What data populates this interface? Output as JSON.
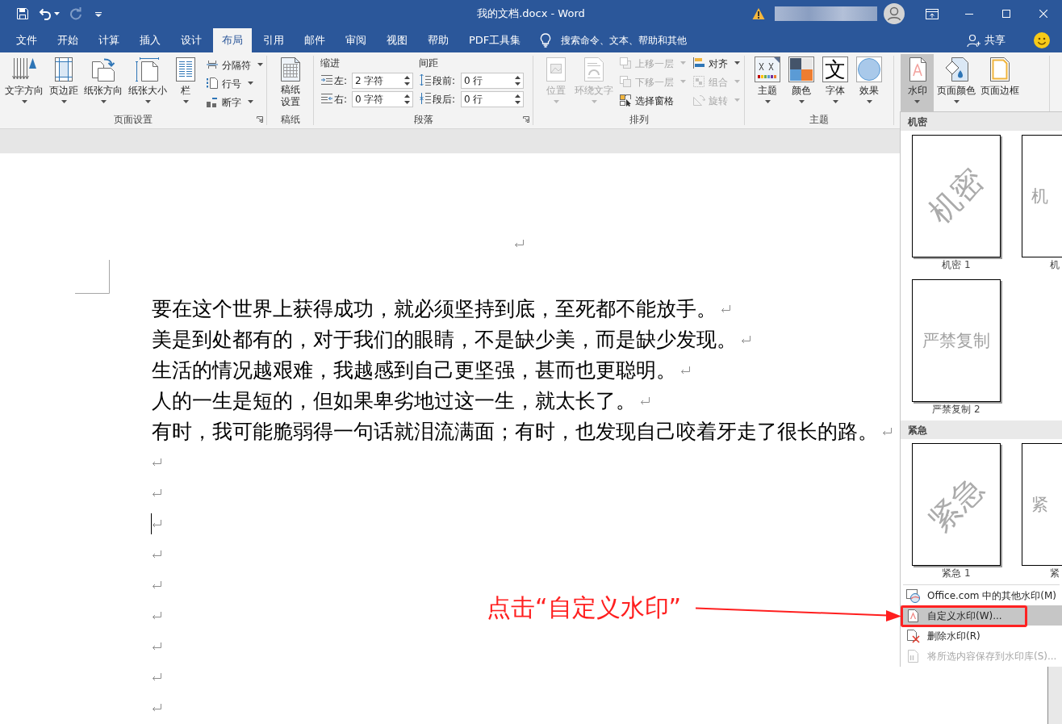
{
  "window": {
    "title": "我的文档.docx - Word"
  },
  "quick_access": [
    {
      "kind": "save",
      "disabled": false
    },
    {
      "kind": "undo",
      "disabled": false
    },
    {
      "kind": "redo",
      "disabled": true
    },
    {
      "kind": "customize",
      "disabled": false
    }
  ],
  "tabs": [
    {
      "label": "文件",
      "selected": false
    },
    {
      "label": "开始",
      "selected": false
    },
    {
      "label": "计算",
      "selected": false
    },
    {
      "label": "插入",
      "selected": false
    },
    {
      "label": "设计",
      "selected": false
    },
    {
      "label": "布局",
      "selected": true
    },
    {
      "label": "引用",
      "selected": false
    },
    {
      "label": "邮件",
      "selected": false
    },
    {
      "label": "审阅",
      "selected": false
    },
    {
      "label": "视图",
      "selected": false
    },
    {
      "label": "帮助",
      "selected": false
    },
    {
      "label": "PDF工具集",
      "selected": false
    }
  ],
  "tell_me": {
    "label": "搜索命令、文本、帮助和其他"
  },
  "share": {
    "label": "共享"
  },
  "ribbon": {
    "page_setup": {
      "label": "页面设置",
      "launcher": true,
      "large_buttons": [
        {
          "kind": "direction",
          "label": "文字方向",
          "dropdown": true
        },
        {
          "kind": "margins",
          "label": "页边距",
          "dropdown": true
        },
        {
          "kind": "orientation",
          "label": "纸张方向",
          "dropdown": true
        },
        {
          "kind": "size",
          "label": "纸张大小",
          "dropdown": true
        },
        {
          "kind": "columns",
          "label": "栏",
          "dropdown": true
        }
      ],
      "small_buttons": [
        {
          "kind": "breaks",
          "label": "分隔符",
          "dropdown": true
        },
        {
          "kind": "numbers",
          "label": "行号",
          "dropdown": true
        },
        {
          "kind": "hyphenation",
          "label": "断字",
          "dropdown": true
        }
      ]
    },
    "manuscript": {
      "label": "稿纸",
      "launcher": false,
      "large_buttons": [
        {
          "kind": "manuscript",
          "label": "稿纸设置",
          "dropdown": false
        }
      ]
    },
    "paragraph": {
      "label": "段落",
      "launcher": true,
      "indent": {
        "title": "缩进",
        "fields": [
          {
            "kind": "left",
            "label": "左:",
            "value": "2 字符"
          },
          {
            "kind": "right",
            "label": "右:",
            "value": "0 字符"
          }
        ]
      },
      "spacing": {
        "title": "间距",
        "fields": [
          {
            "kind": "before",
            "label": "段前:",
            "value": "0 行"
          },
          {
            "kind": "after",
            "label": "段后:",
            "value": "0 行"
          }
        ]
      }
    },
    "arrange": {
      "label": "排列",
      "launcher": false,
      "large_buttons": [
        {
          "kind": "position",
          "label": "位置",
          "dropdown": true,
          "disabled": true
        },
        {
          "kind": "wrap",
          "label": "环绕文字",
          "dropdown": true,
          "disabled": true
        }
      ],
      "small_buttons": [
        {
          "kind": "forward",
          "label": "上移一层",
          "dropdown": true,
          "disabled": true
        },
        {
          "kind": "backward",
          "label": "下移一层",
          "dropdown": true,
          "disabled": true
        },
        {
          "kind": "pane",
          "label": "选择窗格",
          "dropdown": false,
          "disabled": false
        },
        {
          "kind": "align",
          "label": "对齐",
          "dropdown": true,
          "disabled": false
        },
        {
          "kind": "group",
          "label": "组合",
          "dropdown": true,
          "disabled": true
        },
        {
          "kind": "rotate",
          "label": "旋转",
          "dropdown": true,
          "disabled": true
        }
      ]
    },
    "design": {
      "label": "主题",
      "launcher": false,
      "large_buttons": [
        {
          "kind": "themes",
          "label": "主题",
          "dropdown": true
        },
        {
          "kind": "colors",
          "label": "颜色",
          "dropdown": true
        },
        {
          "kind": "fonts",
          "label": "字体",
          "dropdown": true,
          "sample": "文"
        },
        {
          "kind": "effects",
          "label": "效果",
          "dropdown": true
        }
      ]
    },
    "page_background": {
      "large_buttons": [
        {
          "kind": "watermark",
          "label": "水印",
          "dropdown": true,
          "pressed": true
        },
        {
          "kind": "pagecolor",
          "label": "页面颜色",
          "dropdown": true,
          "pressed": false
        },
        {
          "kind": "pageborder",
          "label": "页面边框",
          "dropdown": false,
          "pressed": false
        }
      ]
    }
  },
  "watermark_menu": {
    "sections": [
      {
        "title": "机密",
        "items": [
          {
            "label": "机密 1",
            "watermark": "机密",
            "diagonal": true
          },
          {
            "label": "机",
            "watermark": "机",
            "diagonal": false
          },
          {
            "label": "严禁复制 2",
            "watermark": "严禁复制",
            "diagonal": false
          }
        ]
      },
      {
        "title": "紧急",
        "items": [
          {
            "label": "紧急 1",
            "watermark": "紧急",
            "diagonal": true
          },
          {
            "label": "紧",
            "watermark": "紧",
            "diagonal": false
          }
        ]
      }
    ],
    "commands": [
      {
        "kind": "online",
        "label": "Office.com 中的其他水印(M)",
        "highlighted": false,
        "disabled": false
      },
      {
        "kind": "custom",
        "label": "自定义水印(W)...",
        "highlighted": true,
        "disabled": false
      },
      {
        "kind": "remove",
        "label": "删除水印(R)",
        "highlighted": false,
        "disabled": false
      },
      {
        "kind": "save",
        "label": "将所选内容保存到水印库(S)...",
        "highlighted": false,
        "disabled": true
      }
    ]
  },
  "document": {
    "paragraphs": [
      {
        "text": "要在这个世界上获得成功，就必须坚持到底，至死都不能放手。"
      },
      {
        "text": "美是到处都有的，对于我们的眼睛，不是缺少美，而是缺少发现。"
      },
      {
        "text": "生活的情况越艰难，我越感到自己更坚强，甚而也更聪明。"
      },
      {
        "text": "人的一生是短的，但如果卑劣地过这一生，就太长了。"
      },
      {
        "text": "有时，我可能脆弱得一句话就泪流满面；有时，也发现自己咬着牙走了很长的路。"
      }
    ],
    "empty_paragraphs": [
      {
        "cursor": false
      },
      {
        "cursor": false
      },
      {
        "cursor": true
      },
      {
        "cursor": false
      },
      {
        "cursor": false
      },
      {
        "cursor": false
      },
      {
        "cursor": false
      },
      {
        "cursor": false
      },
      {
        "cursor": false
      }
    ]
  },
  "annotation": {
    "text": "点击“自定义水印”"
  }
}
